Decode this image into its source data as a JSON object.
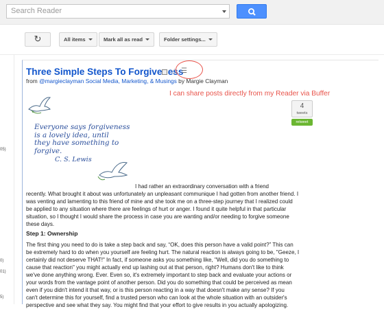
{
  "search": {
    "placeholder": "Search Reader"
  },
  "toolbar": {
    "refresh_icon": "refresh-icon",
    "all_items_label": "All items",
    "mark_all_read_label": "Mark all as read",
    "folder_settings_label": "Folder settings..."
  },
  "gutter": {
    "num1": "05)",
    "num2": "0)",
    "num3": "01)",
    "num4": "5)"
  },
  "entry": {
    "title": "Three Simple Steps To Forgiveness",
    "from_label": "from",
    "source": "@margieclayman Social Media, Marketing, & Musings",
    "by_label": "by",
    "author": "Margie Clayman",
    "star_icon": "star-icon",
    "buffer_icon": "buffer-icon"
  },
  "annotation": "I can share posts directly from my Reader via Buffer",
  "tweet": {
    "count": "4",
    "label": "tweets",
    "retweet": "retweet"
  },
  "quote": {
    "lines": [
      "Everyone says forgiveness",
      "is a lovely idea, until",
      "they have something to",
      "forgive."
    ],
    "author": "C. S. Lewis"
  },
  "body": {
    "p1": [
      "I had rather an extraordinary conversation with a friend",
      "recently. What brought it about was unfortunately an unpleasant communique I had gotten from another friend. I",
      "was venting and lamenting to this friend of mine and she took me on a three-step journey that I realized could",
      "be applied to any situation where there are feelings of hurt or anger. I found it quite helpful in that particular",
      "situation, so I thought I would share the process in case you are wanting and/or needing to forgive someone",
      "these days."
    ],
    "step1": "Step 1: Ownership",
    "p2": [
      "The first thing you need to do is take a step back and say, “OK, does this person have a valid point?” This can",
      "be extremely hard to do when you yourself are feeling hurt. The natural reaction is always going to be, \"Geeze, I",
      "certainly did not deserve THAT!\" In fact, if someone asks you something like, \"Well, did you do something to",
      "cause that reaction\" you might actually end up lashing out at that person, right? Humans don't like to think",
      "we've done anything wrong. Ever. Even so, it's extremely important to step back and evaluate your actions or",
      "your words from the vantage point of another person. Did you do something that could be perceived as mean",
      "even if you didn't intend it that way, or is this person reacting in a way that doesn't make any sense? If you",
      "can't determine this for yourself, find a trusted person who can look at the whole situation with an outsider's",
      "perspective and see what they say. You might find that your effort to give results in you actually apologizing."
    ]
  },
  "colors": {
    "link": "#1155cc",
    "annotation": "#e8534a",
    "search_button": "#4d90fe",
    "quote": "#2b4f9c",
    "retweet": "#6bb632"
  }
}
